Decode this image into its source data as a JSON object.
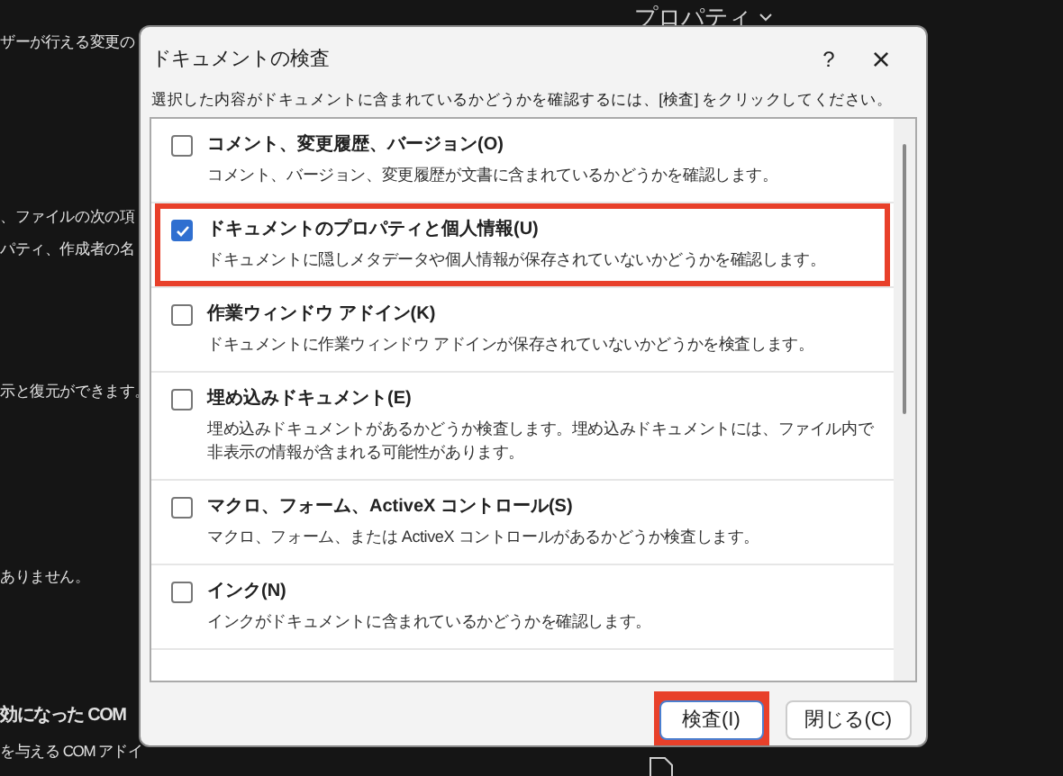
{
  "background": {
    "menu": "プロパティ",
    "texts": [
      "ザーが行える変更の",
      "、ファイルの次の項",
      "パティ、作成者の名",
      "示と復元ができます。",
      "ありません。",
      "効になった COM",
      "を与える COM アドイ"
    ]
  },
  "dialog": {
    "title": "ドキュメントの検査",
    "help": "?",
    "close": "×",
    "instruction": "選択した内容がドキュメントに含まれているかどうかを確認するには、[検査] をクリックしてください。",
    "items": [
      {
        "label": "コメント、変更履歴、バージョン(O)",
        "description": "コメント、バージョン、変更履歴が文書に含まれているかどうかを確認します。",
        "checked": false,
        "highlighted": false
      },
      {
        "label": "ドキュメントのプロパティと個人情報(U)",
        "description": "ドキュメントに隠しメタデータや個人情報が保存されていないかどうかを確認します。",
        "checked": true,
        "highlighted": true
      },
      {
        "label": "作業ウィンドウ アドイン(K)",
        "description": "ドキュメントに作業ウィンドウ アドインが保存されていないかどうかを検査します。",
        "checked": false,
        "highlighted": false
      },
      {
        "label": "埋め込みドキュメント(E)",
        "description": "埋め込みドキュメントがあるかどうか検査します。埋め込みドキュメントには、ファイル内で非表示の情報が含まれる可能性があります。",
        "checked": false,
        "highlighted": false
      },
      {
        "label": "マクロ、フォーム、ActiveX コントロール(S)",
        "description": "マクロ、フォーム、または ActiveX コントロールがあるかどうか検査します。",
        "checked": false,
        "highlighted": false
      },
      {
        "label": "インク(N)",
        "description": "インクがドキュメントに含まれているかどうかを確認します。",
        "checked": false,
        "highlighted": false
      }
    ],
    "buttons": [
      {
        "label": "検査(I)",
        "highlighted": true
      },
      {
        "label": "閉じる(C)",
        "highlighted": false
      }
    ]
  }
}
